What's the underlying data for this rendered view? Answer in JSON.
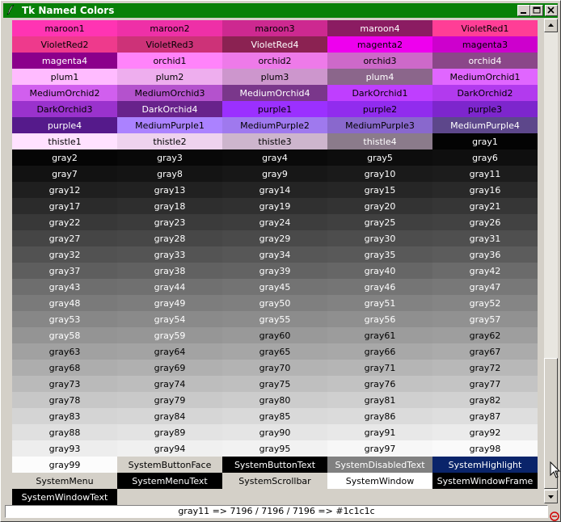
{
  "window": {
    "title": "Tk Named Colors",
    "icons": {
      "app": "feather-icon",
      "minimize": "minimize-icon",
      "maximize": "maximize-icon",
      "close": "close-icon",
      "grip": "resize-grip-icon",
      "cursor": "mouse-cursor-icon"
    },
    "titlebar_color": "#088008"
  },
  "status": {
    "text": "gray11 => 7196 / 7196 / 7196 => #1c1c1c"
  },
  "rows": [
    [
      {
        "name": "maroon1",
        "bg": "#ff34b3",
        "fg": "#000000"
      },
      {
        "name": "maroon2",
        "bg": "#ee30a7",
        "fg": "#000000"
      },
      {
        "name": "maroon3",
        "bg": "#cd2990",
        "fg": "#000000"
      },
      {
        "name": "maroon4",
        "bg": "#8b1c62",
        "fg": "#ffffff"
      },
      {
        "name": "VioletRed1",
        "bg": "#ff3e96",
        "fg": "#000000"
      }
    ],
    [
      {
        "name": "VioletRed2",
        "bg": "#ee3a8c",
        "fg": "#000000"
      },
      {
        "name": "VioletRed3",
        "bg": "#cd3278",
        "fg": "#000000"
      },
      {
        "name": "VioletRed4",
        "bg": "#8b2252",
        "fg": "#ffffff"
      },
      {
        "name": "magenta2",
        "bg": "#ee00ee",
        "fg": "#000000"
      },
      {
        "name": "magenta3",
        "bg": "#cd00cd",
        "fg": "#000000"
      }
    ],
    [
      {
        "name": "magenta4",
        "bg": "#8b008b",
        "fg": "#ffffff"
      },
      {
        "name": "orchid1",
        "bg": "#ff83fa",
        "fg": "#000000"
      },
      {
        "name": "orchid2",
        "bg": "#ee7ae9",
        "fg": "#000000"
      },
      {
        "name": "orchid3",
        "bg": "#cd69c9",
        "fg": "#000000"
      },
      {
        "name": "orchid4",
        "bg": "#8b4789",
        "fg": "#ffffff"
      }
    ],
    [
      {
        "name": "plum1",
        "bg": "#ffbbff",
        "fg": "#000000"
      },
      {
        "name": "plum2",
        "bg": "#eeaeee",
        "fg": "#000000"
      },
      {
        "name": "plum3",
        "bg": "#cd96cd",
        "fg": "#000000"
      },
      {
        "name": "plum4",
        "bg": "#8b668b",
        "fg": "#ffffff"
      },
      {
        "name": "MediumOrchid1",
        "bg": "#e066ff",
        "fg": "#000000"
      }
    ],
    [
      {
        "name": "MediumOrchid2",
        "bg": "#d15fee",
        "fg": "#000000"
      },
      {
        "name": "MediumOrchid3",
        "bg": "#b452cd",
        "fg": "#000000"
      },
      {
        "name": "MediumOrchid4",
        "bg": "#7a378b",
        "fg": "#ffffff"
      },
      {
        "name": "DarkOrchid1",
        "bg": "#bf3eff",
        "fg": "#000000"
      },
      {
        "name": "DarkOrchid2",
        "bg": "#b23aee",
        "fg": "#000000"
      }
    ],
    [
      {
        "name": "DarkOrchid3",
        "bg": "#9a32cd",
        "fg": "#000000"
      },
      {
        "name": "DarkOrchid4",
        "bg": "#68228b",
        "fg": "#ffffff"
      },
      {
        "name": "purple1",
        "bg": "#9b30ff",
        "fg": "#000000"
      },
      {
        "name": "purple2",
        "bg": "#912cee",
        "fg": "#000000"
      },
      {
        "name": "purple3",
        "bg": "#7d26cd",
        "fg": "#000000"
      }
    ],
    [
      {
        "name": "purple4",
        "bg": "#551a8b",
        "fg": "#ffffff"
      },
      {
        "name": "MediumPurple1",
        "bg": "#ab82ff",
        "fg": "#000000"
      },
      {
        "name": "MediumPurple2",
        "bg": "#9f79ee",
        "fg": "#000000"
      },
      {
        "name": "MediumPurple3",
        "bg": "#8968cd",
        "fg": "#000000"
      },
      {
        "name": "MediumPurple4",
        "bg": "#5d478b",
        "fg": "#ffffff"
      }
    ],
    [
      {
        "name": "thistle1",
        "bg": "#ffe1ff",
        "fg": "#000000"
      },
      {
        "name": "thistle2",
        "bg": "#eed2ee",
        "fg": "#000000"
      },
      {
        "name": "thistle3",
        "bg": "#cdb5cd",
        "fg": "#000000"
      },
      {
        "name": "thistle4",
        "bg": "#8b7b8b",
        "fg": "#ffffff"
      },
      {
        "name": "gray1",
        "bg": "#030303",
        "fg": "#ffffff"
      }
    ],
    [
      {
        "name": "gray2",
        "bg": "#050505",
        "fg": "#ffffff"
      },
      {
        "name": "gray3",
        "bg": "#080808",
        "fg": "#ffffff"
      },
      {
        "name": "gray4",
        "bg": "#0a0a0a",
        "fg": "#ffffff"
      },
      {
        "name": "gray5",
        "bg": "#0d0d0d",
        "fg": "#ffffff"
      },
      {
        "name": "gray6",
        "bg": "#0f0f0f",
        "fg": "#ffffff"
      }
    ],
    [
      {
        "name": "gray7",
        "bg": "#121212",
        "fg": "#ffffff"
      },
      {
        "name": "gray8",
        "bg": "#141414",
        "fg": "#ffffff"
      },
      {
        "name": "gray9",
        "bg": "#171717",
        "fg": "#ffffff"
      },
      {
        "name": "gray10",
        "bg": "#1a1a1a",
        "fg": "#ffffff"
      },
      {
        "name": "gray11",
        "bg": "#1c1c1c",
        "fg": "#ffffff"
      }
    ],
    [
      {
        "name": "gray12",
        "bg": "#1f1f1f",
        "fg": "#ffffff"
      },
      {
        "name": "gray13",
        "bg": "#212121",
        "fg": "#ffffff"
      },
      {
        "name": "gray14",
        "bg": "#242424",
        "fg": "#ffffff"
      },
      {
        "name": "gray15",
        "bg": "#262626",
        "fg": "#ffffff"
      },
      {
        "name": "gray16",
        "bg": "#292929",
        "fg": "#ffffff"
      }
    ],
    [
      {
        "name": "gray17",
        "bg": "#2b2b2b",
        "fg": "#ffffff"
      },
      {
        "name": "gray18",
        "bg": "#2e2e2e",
        "fg": "#ffffff"
      },
      {
        "name": "gray19",
        "bg": "#303030",
        "fg": "#ffffff"
      },
      {
        "name": "gray20",
        "bg": "#333333",
        "fg": "#ffffff"
      },
      {
        "name": "gray21",
        "bg": "#363636",
        "fg": "#ffffff"
      }
    ],
    [
      {
        "name": "gray22",
        "bg": "#383838",
        "fg": "#ffffff"
      },
      {
        "name": "gray23",
        "bg": "#3b3b3b",
        "fg": "#ffffff"
      },
      {
        "name": "gray24",
        "bg": "#3d3d3d",
        "fg": "#ffffff"
      },
      {
        "name": "gray25",
        "bg": "#404040",
        "fg": "#ffffff"
      },
      {
        "name": "gray26",
        "bg": "#424242",
        "fg": "#ffffff"
      }
    ],
    [
      {
        "name": "gray27",
        "bg": "#454545",
        "fg": "#ffffff"
      },
      {
        "name": "gray28",
        "bg": "#474747",
        "fg": "#ffffff"
      },
      {
        "name": "gray29",
        "bg": "#4a4a4a",
        "fg": "#ffffff"
      },
      {
        "name": "gray30",
        "bg": "#4d4d4d",
        "fg": "#ffffff"
      },
      {
        "name": "gray31",
        "bg": "#4f4f4f",
        "fg": "#ffffff"
      }
    ],
    [
      {
        "name": "gray32",
        "bg": "#525252",
        "fg": "#ffffff"
      },
      {
        "name": "gray33",
        "bg": "#545454",
        "fg": "#ffffff"
      },
      {
        "name": "gray34",
        "bg": "#575757",
        "fg": "#ffffff"
      },
      {
        "name": "gray35",
        "bg": "#595959",
        "fg": "#ffffff"
      },
      {
        "name": "gray36",
        "bg": "#5c5c5c",
        "fg": "#ffffff"
      }
    ],
    [
      {
        "name": "gray37",
        "bg": "#5e5e5e",
        "fg": "#ffffff"
      },
      {
        "name": "gray38",
        "bg": "#616161",
        "fg": "#ffffff"
      },
      {
        "name": "gray39",
        "bg": "#636363",
        "fg": "#ffffff"
      },
      {
        "name": "gray40",
        "bg": "#666666",
        "fg": "#ffffff"
      },
      {
        "name": "gray42",
        "bg": "#6b6b6b",
        "fg": "#ffffff"
      }
    ],
    [
      {
        "name": "gray43",
        "bg": "#6e6e6e",
        "fg": "#ffffff"
      },
      {
        "name": "gray44",
        "bg": "#707070",
        "fg": "#ffffff"
      },
      {
        "name": "gray45",
        "bg": "#737373",
        "fg": "#ffffff"
      },
      {
        "name": "gray46",
        "bg": "#757575",
        "fg": "#ffffff"
      },
      {
        "name": "gray47",
        "bg": "#787878",
        "fg": "#ffffff"
      }
    ],
    [
      {
        "name": "gray48",
        "bg": "#7a7a7a",
        "fg": "#ffffff"
      },
      {
        "name": "gray49",
        "bg": "#7d7d7d",
        "fg": "#ffffff"
      },
      {
        "name": "gray50",
        "bg": "#7f7f7f",
        "fg": "#ffffff"
      },
      {
        "name": "gray51",
        "bg": "#828282",
        "fg": "#ffffff"
      },
      {
        "name": "gray52",
        "bg": "#858585",
        "fg": "#ffffff"
      }
    ],
    [
      {
        "name": "gray53",
        "bg": "#878787",
        "fg": "#ffffff"
      },
      {
        "name": "gray54",
        "bg": "#8a8a8a",
        "fg": "#ffffff"
      },
      {
        "name": "gray55",
        "bg": "#8c8c8c",
        "fg": "#ffffff"
      },
      {
        "name": "gray56",
        "bg": "#8f8f8f",
        "fg": "#ffffff"
      },
      {
        "name": "gray57",
        "bg": "#919191",
        "fg": "#ffffff"
      }
    ],
    [
      {
        "name": "gray58",
        "bg": "#949494",
        "fg": "#ffffff"
      },
      {
        "name": "gray59",
        "bg": "#969696",
        "fg": "#ffffff"
      },
      {
        "name": "gray60",
        "bg": "#999999",
        "fg": "#000000"
      },
      {
        "name": "gray61",
        "bg": "#9c9c9c",
        "fg": "#000000"
      },
      {
        "name": "gray62",
        "bg": "#9e9e9e",
        "fg": "#000000"
      }
    ],
    [
      {
        "name": "gray63",
        "bg": "#a1a1a1",
        "fg": "#000000"
      },
      {
        "name": "gray64",
        "bg": "#a3a3a3",
        "fg": "#000000"
      },
      {
        "name": "gray65",
        "bg": "#a6a6a6",
        "fg": "#000000"
      },
      {
        "name": "gray66",
        "bg": "#a8a8a8",
        "fg": "#000000"
      },
      {
        "name": "gray67",
        "bg": "#ababab",
        "fg": "#000000"
      }
    ],
    [
      {
        "name": "gray68",
        "bg": "#adadad",
        "fg": "#000000"
      },
      {
        "name": "gray69",
        "bg": "#b0b0b0",
        "fg": "#000000"
      },
      {
        "name": "gray70",
        "bg": "#b3b3b3",
        "fg": "#000000"
      },
      {
        "name": "gray71",
        "bg": "#b5b5b5",
        "fg": "#000000"
      },
      {
        "name": "gray72",
        "bg": "#b8b8b8",
        "fg": "#000000"
      }
    ],
    [
      {
        "name": "gray73",
        "bg": "#bababa",
        "fg": "#000000"
      },
      {
        "name": "gray74",
        "bg": "#bdbdbd",
        "fg": "#000000"
      },
      {
        "name": "gray75",
        "bg": "#bfbfbf",
        "fg": "#000000"
      },
      {
        "name": "gray76",
        "bg": "#c2c2c2",
        "fg": "#000000"
      },
      {
        "name": "gray77",
        "bg": "#c4c4c4",
        "fg": "#000000"
      }
    ],
    [
      {
        "name": "gray78",
        "bg": "#c7c7c7",
        "fg": "#000000"
      },
      {
        "name": "gray79",
        "bg": "#c9c9c9",
        "fg": "#000000"
      },
      {
        "name": "gray80",
        "bg": "#cccccc",
        "fg": "#000000"
      },
      {
        "name": "gray81",
        "bg": "#cfcfcf",
        "fg": "#000000"
      },
      {
        "name": "gray82",
        "bg": "#d1d1d1",
        "fg": "#000000"
      }
    ],
    [
      {
        "name": "gray83",
        "bg": "#d4d4d4",
        "fg": "#000000"
      },
      {
        "name": "gray84",
        "bg": "#d6d6d6",
        "fg": "#000000"
      },
      {
        "name": "gray85",
        "bg": "#d9d9d9",
        "fg": "#000000"
      },
      {
        "name": "gray86",
        "bg": "#dbdbdb",
        "fg": "#000000"
      },
      {
        "name": "gray87",
        "bg": "#dedede",
        "fg": "#000000"
      }
    ],
    [
      {
        "name": "gray88",
        "bg": "#e0e0e0",
        "fg": "#000000"
      },
      {
        "name": "gray89",
        "bg": "#e3e3e3",
        "fg": "#000000"
      },
      {
        "name": "gray90",
        "bg": "#e5e5e5",
        "fg": "#000000"
      },
      {
        "name": "gray91",
        "bg": "#e8e8e8",
        "fg": "#000000"
      },
      {
        "name": "gray92",
        "bg": "#ebebeb",
        "fg": "#000000"
      }
    ],
    [
      {
        "name": "gray93",
        "bg": "#ededed",
        "fg": "#000000"
      },
      {
        "name": "gray94",
        "bg": "#f0f0f0",
        "fg": "#000000"
      },
      {
        "name": "gray95",
        "bg": "#f2f2f2",
        "fg": "#000000"
      },
      {
        "name": "gray97",
        "bg": "#f7f7f7",
        "fg": "#000000"
      },
      {
        "name": "gray98",
        "bg": "#fafafa",
        "fg": "#000000"
      }
    ],
    [
      {
        "name": "gray99",
        "bg": "#fcfcfc",
        "fg": "#000000"
      },
      {
        "name": "SystemButtonFace",
        "bg": "#d4d0c8",
        "fg": "#000000"
      },
      {
        "name": "SystemButtonText",
        "bg": "#000000",
        "fg": "#ffffff"
      },
      {
        "name": "SystemDisabledText",
        "bg": "#808080",
        "fg": "#ffffff"
      },
      {
        "name": "SystemHighlight",
        "bg": "#0a246a",
        "fg": "#ffffff"
      }
    ],
    [
      {
        "name": "SystemMenu",
        "bg": "#d4d0c8",
        "fg": "#000000"
      },
      {
        "name": "SystemMenuText",
        "bg": "#000000",
        "fg": "#ffffff"
      },
      {
        "name": "SystemScrollbar",
        "bg": "#d4d0c8",
        "fg": "#000000"
      },
      {
        "name": "SystemWindow",
        "bg": "#ffffff",
        "fg": "#000000"
      },
      {
        "name": "SystemWindowFrame",
        "bg": "#000000",
        "fg": "#ffffff"
      }
    ],
    [
      {
        "name": "SystemWindowText",
        "bg": "#000000",
        "fg": "#ffffff"
      }
    ]
  ]
}
